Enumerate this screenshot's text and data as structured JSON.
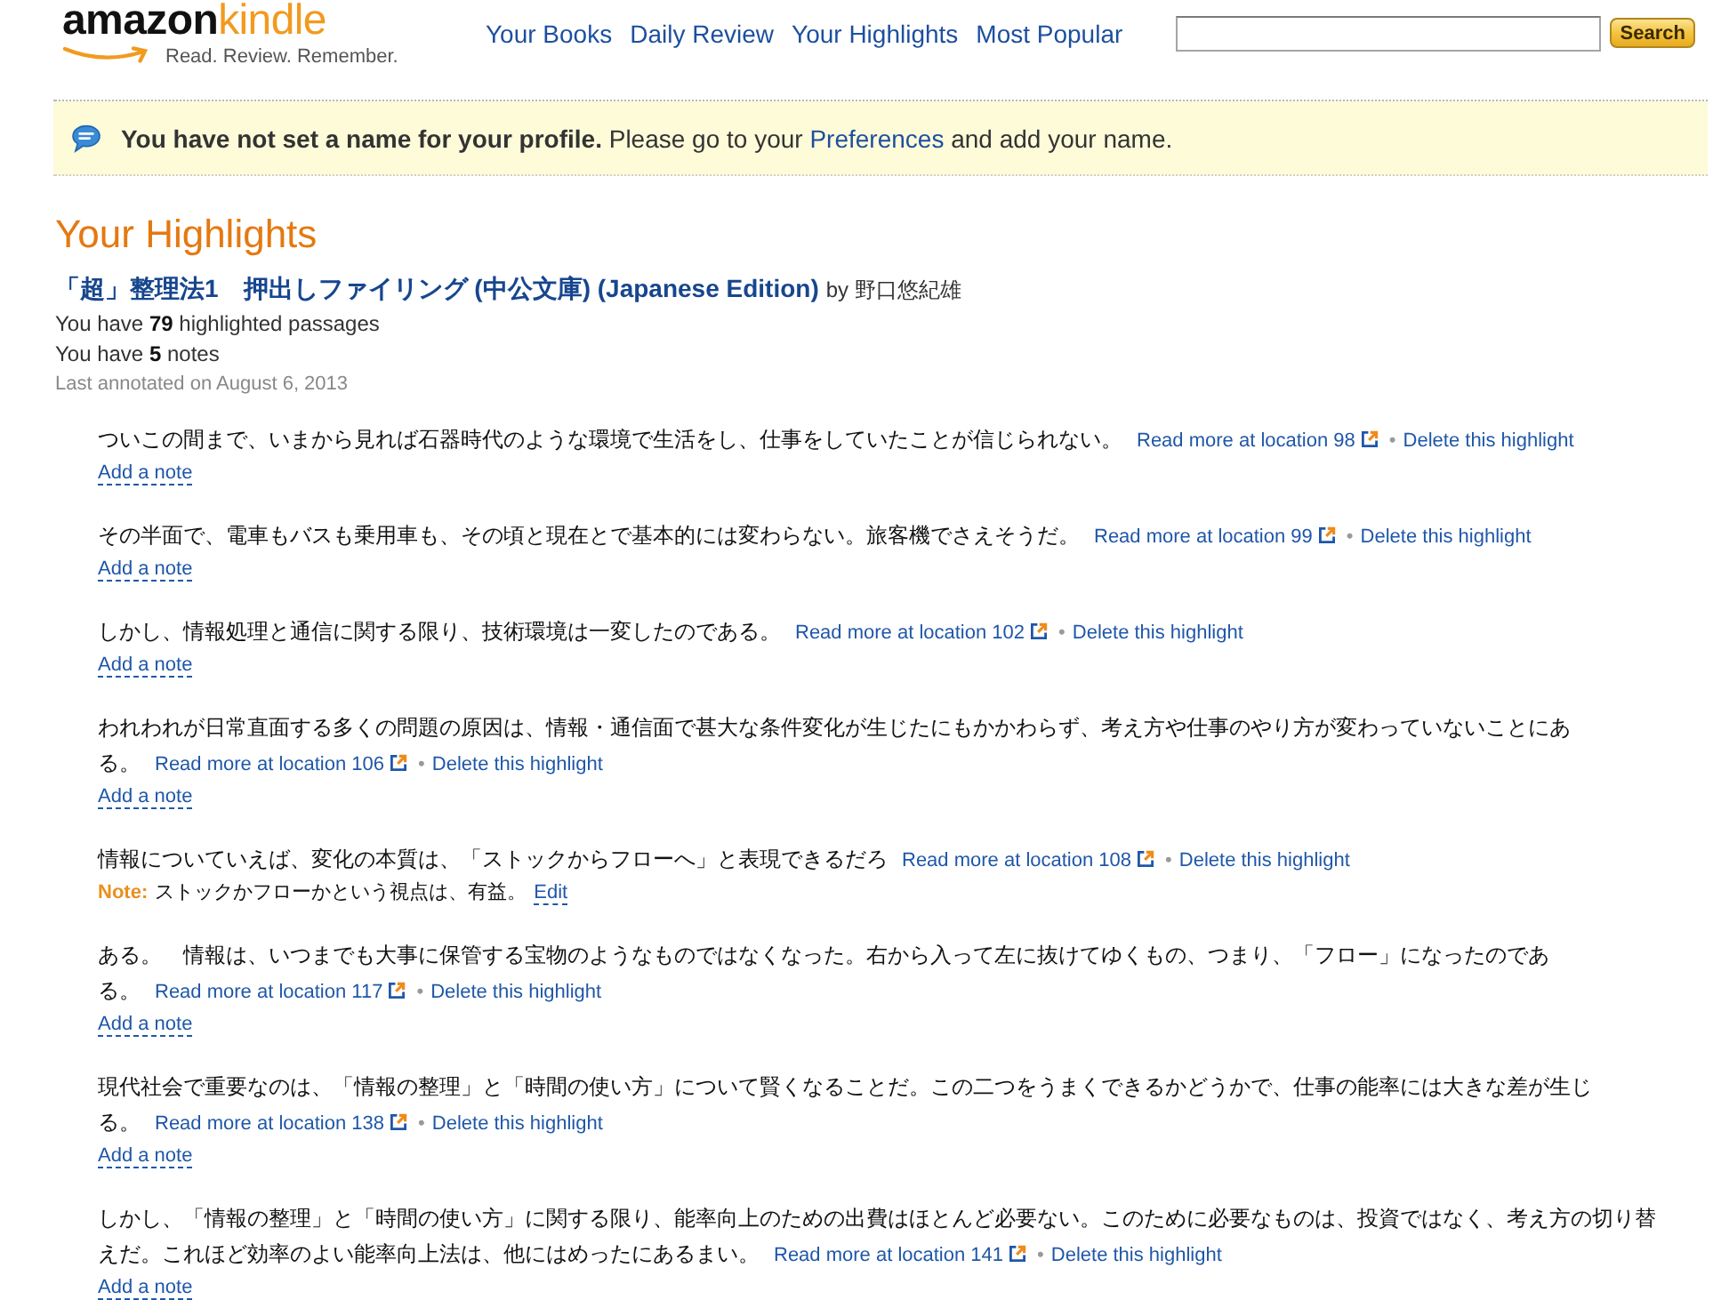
{
  "header": {
    "logo": {
      "brand": "amazon",
      "product": "kindle",
      "tagline": "Read. Review. Remember."
    },
    "nav": [
      {
        "label": "Your Books"
      },
      {
        "label": "Daily Review"
      },
      {
        "label": "Your Highlights"
      },
      {
        "label": "Most Popular"
      }
    ],
    "search": {
      "button": "Search"
    }
  },
  "notice": {
    "message": "**You have not set a name for your profile.** Please go to your",
    "link": "Preferences",
    "message_end": "and add your name."
  },
  "page_title": "Your Highlights",
  "book": {
    "title": "「超」整理法1　押出しファイリング (中公文庫) (Japanese Edition)",
    "byline": "by 野口悠紀雄",
    "stats": [
      "You have **79** highlighted passages",
      "You have **5** notes"
    ],
    "last_annotated": "Last annotated on August 6, 2013"
  },
  "highlights": [
    {
      "kind": "plain",
      "lines": [
        "ついこの間まで、いまから見れば石器時代のような環境で生活をし、仕事をしていたことが信じられない。"
      ],
      "read_more": "Read more at location 98",
      "separator": "•",
      "delete": "Delete this highlight",
      "add_note": "Add a note"
    },
    {
      "kind": "plain",
      "lines": [
        "その半面で、電車もバスも乗用車も、その頃と現在とで基本的には変わらない。旅客機でさえそうだ。"
      ],
      "read_more": "Read more at location 99",
      "separator": "•",
      "delete": "Delete this highlight",
      "add_note": "Add a note"
    },
    {
      "kind": "plain",
      "lines": [
        "しかし、情報処理と通信に関する限り、技術環境は一変したのである。"
      ],
      "read_more": "Read more at location 102",
      "separator": "•",
      "delete": "Delete this highlight",
      "add_note": "Add a note"
    },
    {
      "kind": "plain",
      "lines": [
        "われわれが日常直面する多くの問題の原因は、情報・通信面で甚大な条件変化が生じたにもかかわらず、考え方や仕事のやり方が変わっていないことにあ",
        "る。"
      ],
      "read_more": "Read more at location 106",
      "separator": "•",
      "delete": "Delete this highlight",
      "add_note": "Add a note"
    },
    {
      "kind": "note",
      "lines": [
        "情報についていえば、変化の本質は、「ストックからフローへ」と表現できるだろ"
      ],
      "read_more": "Read more at location 108",
      "separator": "•",
      "delete": "Delete this highlight",
      "note": {
        "label": "Note:",
        "text": "ストックかフローかという視点は、有益。",
        "edit": "Edit"
      }
    },
    {
      "kind": "plain",
      "lines": [
        "ある。　情報は、いつまでも大事に保管する宝物のようなものではなくなった。右から入って左に抜けてゆくもの、つまり、「フロー」になったのであ",
        "る。"
      ],
      "read_more": "Read more at location 117",
      "separator": "•",
      "delete": "Delete this highlight",
      "add_note": "Add a note"
    },
    {
      "kind": "plain",
      "lines": [
        "現代社会で重要なのは、「情報の整理」と「時間の使い方」について賢くなることだ。この二つをうまくできるかどうかで、仕事の能率には大きな差が生じ",
        "る。"
      ],
      "read_more": "Read more at location 138",
      "separator": "•",
      "delete": "Delete this highlight",
      "add_note": "Add a note"
    },
    {
      "kind": "plain",
      "lines": [
        "しかし、「情報の整理」と「時間の使い方」に関する限り、能率向上のための出費はほとんど必要ない。このために必要なものは、投資ではなく、考え方の切り替",
        "えだ。これほど効率のよい能率向上法は、他にはめったにあるまい。"
      ],
      "read_more": "Read more at location 141",
      "separator": "•",
      "delete": "Delete this highlight",
      "add_note": "Add a note"
    }
  ]
}
